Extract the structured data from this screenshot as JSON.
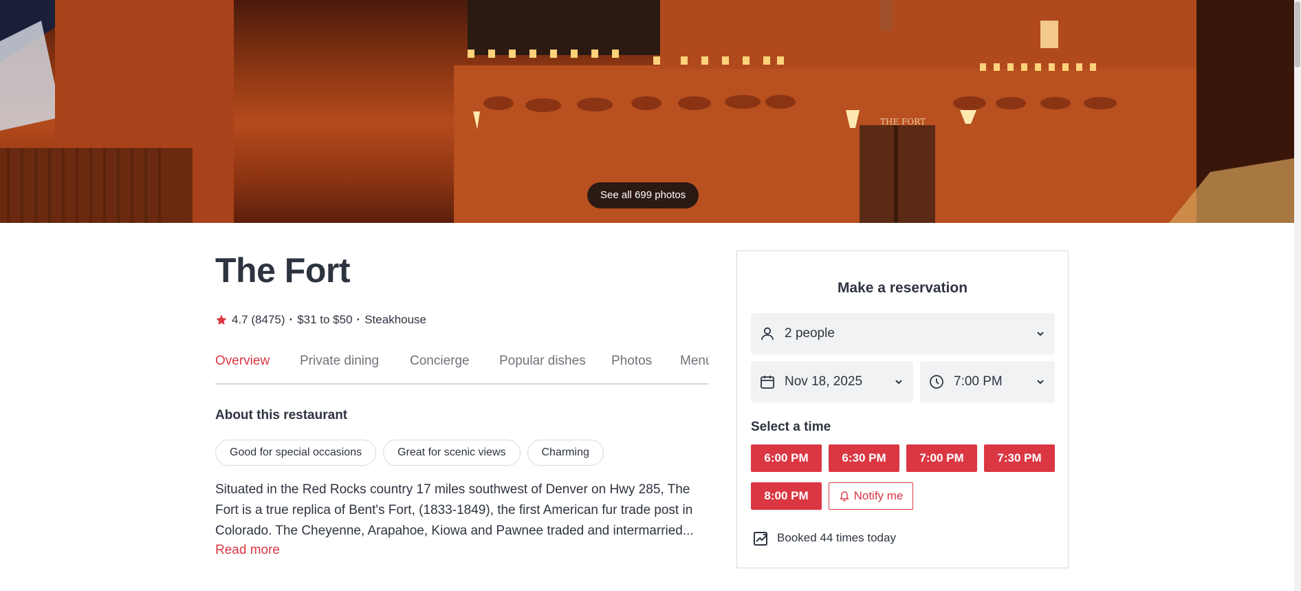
{
  "hero": {
    "photos_button_label": "See all 699 photos",
    "sign_text": "THE FORT"
  },
  "restaurant": {
    "name": "The Fort",
    "rating": "4.7",
    "review_count": "(8475)",
    "price_range": "$31 to $50",
    "cuisine": "Steakhouse"
  },
  "tabs": [
    {
      "label": "Overview",
      "active": true
    },
    {
      "label": "Private dining",
      "active": false
    },
    {
      "label": "Concierge",
      "active": false
    },
    {
      "label": "Popular dishes",
      "active": false
    },
    {
      "label": "Photos",
      "active": false
    },
    {
      "label": "Menu",
      "active": false
    }
  ],
  "about": {
    "heading": "About this restaurant",
    "tags": [
      "Good for special occasions",
      "Great for scenic views",
      "Charming"
    ],
    "description": "Situated in the Red Rocks country 17 miles southwest of Denver on Hwy 285, The Fort is a true replica of Bent's Fort, (1833-1849), the first American fur trade post in Colorado. The Cheyenne, Arapahoe, Kiowa and Pawnee traded and intermarried...",
    "read_more": "Read more"
  },
  "reservation": {
    "title": "Make a reservation",
    "party_size": "2 people",
    "date": "Nov 18, 2025",
    "time": "7:00 PM",
    "select_time_label": "Select a time",
    "slots": [
      "6:00 PM",
      "6:30 PM",
      "7:00 PM",
      "7:30 PM",
      "8:00 PM"
    ],
    "notify_label": "Notify me",
    "booked_text": "Booked 44 times today"
  },
  "colors": {
    "accent": "#da3743",
    "text": "#2d333f",
    "muted": "#6f737b",
    "border": "#d8d9db",
    "field_bg": "#f1f2f4"
  }
}
